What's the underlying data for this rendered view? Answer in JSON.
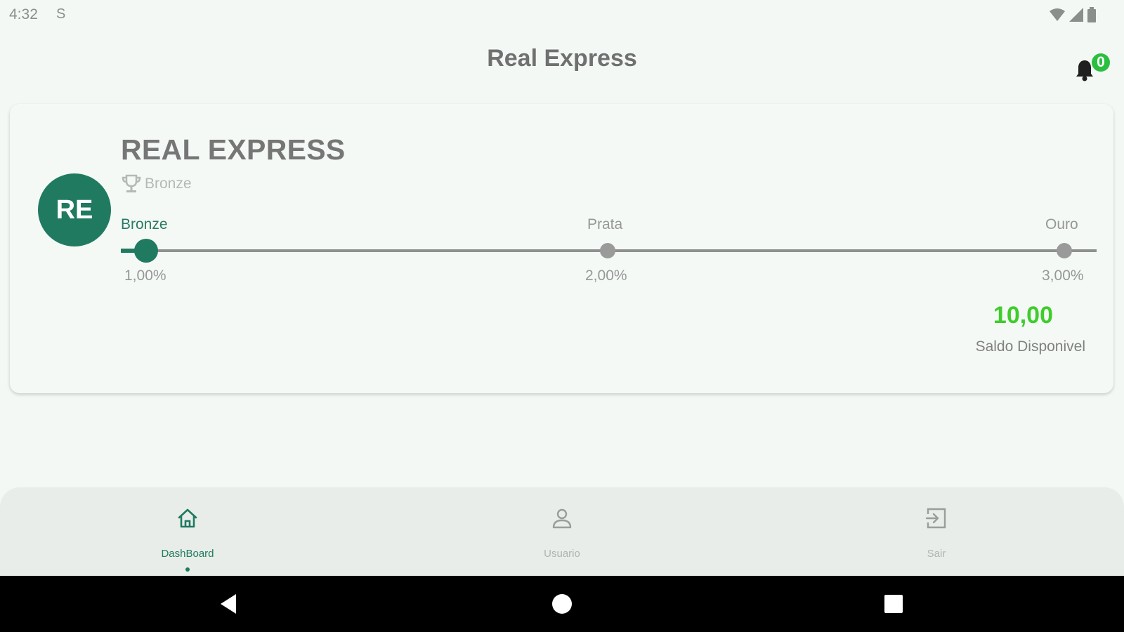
{
  "status_bar": {
    "time": "4:32",
    "left_icon": "S",
    "icons": [
      "wifi-icon",
      "signal-icon",
      "battery-icon"
    ]
  },
  "app_bar": {
    "title": "Real Express",
    "notification_count": "0"
  },
  "profile_card": {
    "avatar_initials": "RE",
    "company_name": "REAL EXPRESS",
    "tier_icon": "trophy-icon",
    "tier": "Bronze",
    "progress": {
      "current_level_index": 0,
      "levels": [
        {
          "name": "Bronze",
          "rate": "1,00%"
        },
        {
          "name": "Prata",
          "rate": "2,00%"
        },
        {
          "name": "Ouro",
          "rate": "3,00%"
        }
      ]
    },
    "balance": {
      "value": "10,00",
      "label": "Saldo Disponivel"
    }
  },
  "bottom_nav": {
    "items": [
      {
        "label": "DashBoard",
        "icon": "home-icon",
        "active": true
      },
      {
        "label": "Usuario",
        "icon": "user-icon",
        "active": false
      },
      {
        "label": "Sair",
        "icon": "logout-icon",
        "active": false
      }
    ]
  },
  "system_nav": {
    "buttons": [
      "back-icon",
      "home-circle-icon",
      "recents-icon"
    ]
  },
  "colors": {
    "primary": "#207a60",
    "balance_green": "#3fcc2c",
    "badge_green": "#2bbf3f",
    "background": "#f3f8f5"
  }
}
